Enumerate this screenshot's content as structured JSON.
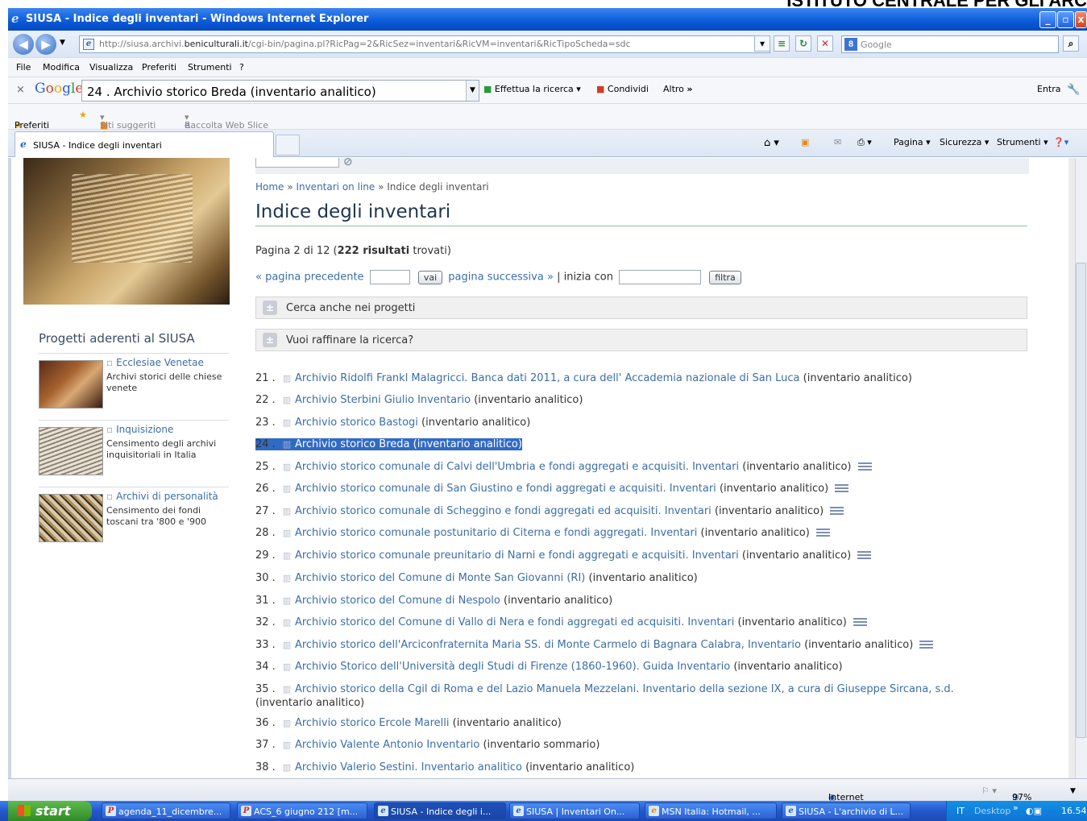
{
  "top_banner": "ISTITUTO CENTRALE PER GLI ARC",
  "window": {
    "title": "SIUSA - Indice degli inventari - Windows Internet Explorer"
  },
  "address_bar": {
    "url_pre": "http://siusa.archivi.",
    "url_host": "beniculturali.it",
    "url_post": "/cgi-bin/pagina.pl?RicPag=2&RicSez=inventari&RicVM=inventari&RicTipoScheda=sdc",
    "search_placeholder": "Google"
  },
  "menu": [
    "File",
    "Modifica",
    "Visualizza",
    "Preferiti",
    "Strumenti",
    "?"
  ],
  "google_toolbar": {
    "query": "24 . Archivio storico Breda (inventario analitico)",
    "search_btn": "Effettua la ricerca",
    "share": "Condividi",
    "more": "Altro",
    "signin": "Entra"
  },
  "favorites_bar": {
    "favorites": "Preferiti",
    "suggested": "Siti suggeriti",
    "webslice": "Raccolta Web Slice"
  },
  "tab": {
    "label": "SIUSA - Indice degli inventari"
  },
  "command_bar": {
    "page": "Pagina",
    "security": "Sicurezza",
    "tools": "Strumenti"
  },
  "sidebar": {
    "projects_title": "Progetti aderenti al SIUSA",
    "projects": [
      {
        "name": "Ecclesiae Venetae",
        "desc": "Archivi storici delle chiese venete"
      },
      {
        "name": "Inquisizione",
        "desc": "Censimento degli archivi inquisitoriali in Italia"
      },
      {
        "name": "Archivi di personalità",
        "desc": "Censimento dei fondi toscani tra '800 e '900"
      }
    ]
  },
  "breadcrumb": {
    "home": "Home",
    "sep": "»",
    "inventari": "Inventari on line",
    "current": "Indice degli inventari"
  },
  "page_title": "Indice degli inventari",
  "results_info": {
    "prefix": "Pagina 2 di 12 (",
    "count": "222 risultati",
    "suffix": " trovati)"
  },
  "pager": {
    "prev": "« pagina precedente",
    "go": "vai",
    "next": "pagina successiva »",
    "sep": "|",
    "starts_with": "inizia con",
    "filter": "filtra"
  },
  "panels": {
    "projects": "Cerca anche nei progetti",
    "refine": "Vuoi raffinare la ricerca?"
  },
  "results": [
    {
      "num": "21 .",
      "link": "Archivio Ridolfi Frankl Malagricci. Banca dati 2011, a cura dell' Accademia nazionale di San Luca",
      "type": "(inventario analitico)"
    },
    {
      "num": "22 .",
      "link": "Archivio Sterbini Giulio Inventario",
      "type": "(inventario analitico)"
    },
    {
      "num": "23 .",
      "link": "Archivio storico Bastogi",
      "type": "(inventario analitico)"
    },
    {
      "num": "24 .",
      "link": "Archivio storico Breda",
      "type": "(inventario analitico)"
    },
    {
      "num": "25 .",
      "link": "Archivio storico comunale di Calvi dell'Umbria e fondi aggregati e acquisiti. Inventari",
      "type": "(inventario analitico)"
    },
    {
      "num": "26 .",
      "link": "Archivio storico comunale di San Giustino e fondi aggregati e acquisiti. Inventari",
      "type": "(inventario analitico)"
    },
    {
      "num": "27 .",
      "link": "Archivio storico comunale di Scheggino e fondi aggregati ed acquisiti. Inventari",
      "type": "(inventario analitico)"
    },
    {
      "num": "28 .",
      "link": "Archivio storico comunale postunitario di Citerna e fondi aggregati. Inventari",
      "type": "(inventario analitico)"
    },
    {
      "num": "29 .",
      "link": "Archivio storico comunale preunitario di Narni e fondi aggregati e acquisiti. Inventari",
      "type": "(inventario analitico)"
    },
    {
      "num": "30 .",
      "link": "Archivio storico del Comune di Monte San Giovanni (RI)",
      "type": "(inventario analitico)"
    },
    {
      "num": "31 .",
      "link": "Archivio storico del Comune di Nespolo",
      "type": "(inventario analitico)"
    },
    {
      "num": "32 .",
      "link": "Archivio storico del Comune di Vallo di Nera e fondi aggregati ed acquisiti. Inventari",
      "type": "(inventario analitico)"
    },
    {
      "num": "33 .",
      "link": "Archivio storico dell'Arciconfraternita Maria SS. di Monte Carmelo di Bagnara Calabra, Inventario",
      "type": "(inventario analitico)"
    },
    {
      "num": "34 .",
      "link": "Archivio Storico dell'Università degli Studi di Firenze (1860-1960). Guida Inventario",
      "type": "(inventario analitico)"
    },
    {
      "num": "35 .",
      "link": "Archivio storico della Cgil di Roma e del Lazio Manuela Mezzelani. Inventario della sezione IX, a cura di Giuseppe Sircana, s.d.",
      "type": "(inventario analitico)"
    },
    {
      "num": "36 .",
      "link": "Archivio storico Ercole Marelli",
      "type": "(inventario analitico)"
    },
    {
      "num": "37 .",
      "link": "Archivio Valente Antonio Inventario",
      "type": "(inventario sommario)"
    },
    {
      "num": "38 .",
      "link": "Archivio Valerio Sestini. Inventario analitico",
      "type": "(inventario analitico)"
    }
  ],
  "status": {
    "zone": "Internet",
    "zoom": "97%"
  },
  "taskbar": {
    "start": "start",
    "tasks": [
      "agenda_11_dicembre...",
      "ACS_6 giugno 212 [m...",
      "SIUSA - Indice degli i...",
      "SIUSA | Inventari On...",
      "MSN Italia: Hotmail, ...",
      "SIUSA - L'archivio di L..."
    ],
    "lang": "IT",
    "desktop": "Desktop",
    "time": "16.54"
  }
}
